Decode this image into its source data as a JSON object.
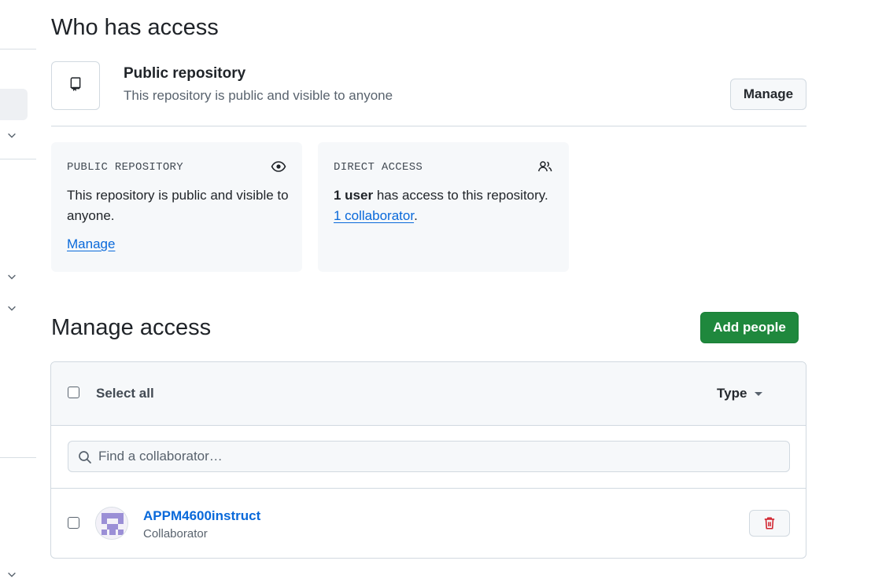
{
  "page": {
    "title": "Who has access",
    "manage_access_title": "Manage access"
  },
  "visibility": {
    "title": "Public repository",
    "subtitle": "This repository is public and visible to anyone",
    "manage_button": "Manage",
    "icon": "repo-icon"
  },
  "cards": {
    "public": {
      "label": "PUBLIC REPOSITORY",
      "text": "This repository is public and visible to anyone.",
      "link": "Manage",
      "icon": "eye-icon"
    },
    "direct": {
      "label": "DIRECT ACCESS",
      "count_bold": "1 user",
      "text": " has access to this repository.",
      "link": "1 collaborator",
      "after_link": ".",
      "icon": "people-icon"
    }
  },
  "add_people_button": "Add people",
  "table": {
    "select_all": "Select all",
    "type_filter": "Type",
    "search_placeholder": "Find a collaborator…",
    "rows": [
      {
        "name": "APPM4600instruct",
        "role": "Collaborator"
      }
    ]
  },
  "colors": {
    "primary_green": "#1f883d",
    "link_blue": "#0969da",
    "danger_red": "#d1242f"
  }
}
